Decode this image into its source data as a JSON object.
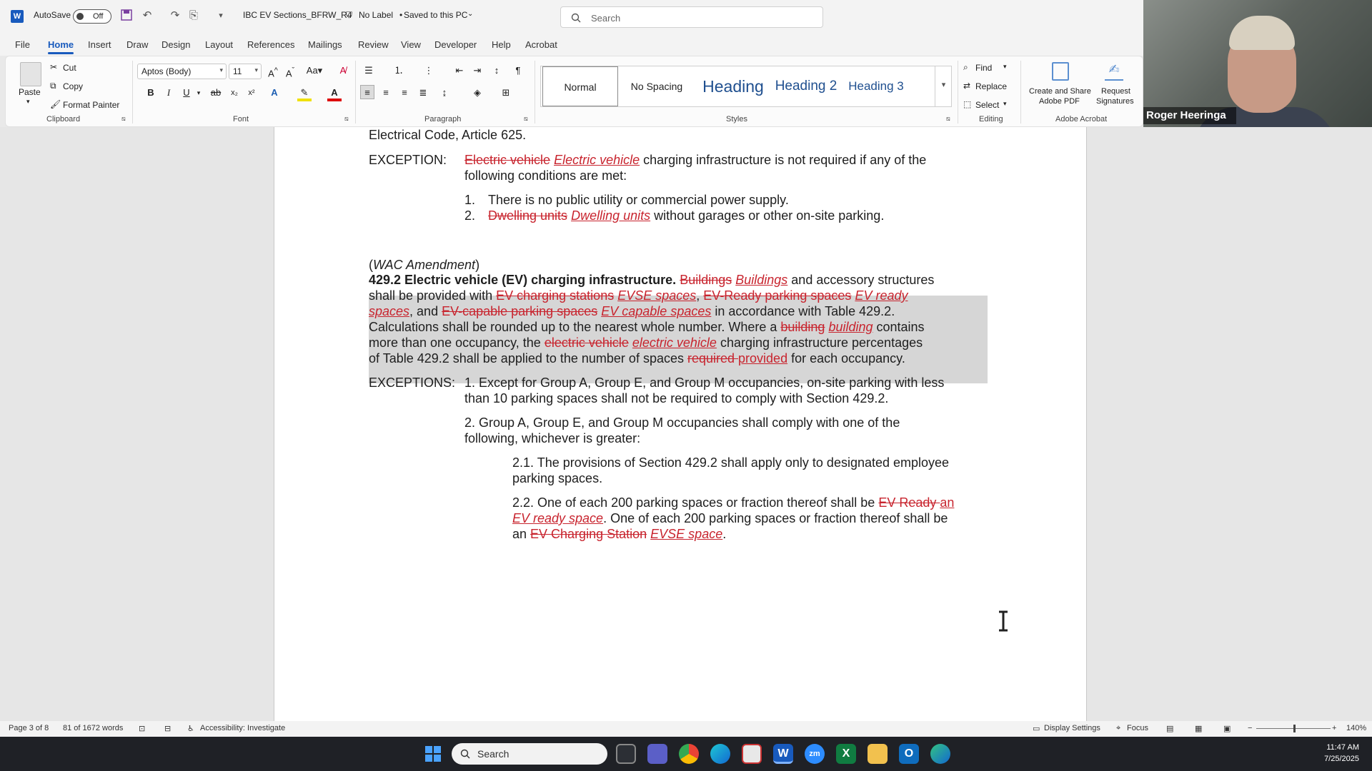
{
  "titlebar": {
    "autosave_label": "AutoSave",
    "autosave_state": "Off",
    "doc_title": "IBC EV Sections_BFRW_R4",
    "sensitivity": "No Label",
    "save_status": "Saved to this PC",
    "search_placeholder": "Search"
  },
  "menu": [
    "File",
    "Home",
    "Insert",
    "Draw",
    "Design",
    "Layout",
    "References",
    "Mailings",
    "Review",
    "View",
    "Developer",
    "Help",
    "Acrobat"
  ],
  "ribbon": {
    "clipboard": {
      "paste": "Paste",
      "cut": "Cut",
      "copy": "Copy",
      "format_painter": "Format Painter",
      "label": "Clipboard"
    },
    "font": {
      "family": "Aptos (Body)",
      "size": "11",
      "label": "Font"
    },
    "paragraph": {
      "label": "Paragraph"
    },
    "styles": {
      "items": [
        "Normal",
        "No Spacing",
        "Heading",
        "Heading 2",
        "Heading 3"
      ],
      "label": "Styles"
    },
    "editing": {
      "find": "Find",
      "replace": "Replace",
      "select": "Select",
      "label": "Editing"
    },
    "acrobat": {
      "create_share": "Create and Share",
      "create_share_2": "Adobe PDF",
      "request": "Request",
      "request_2": "Signatures",
      "label": "Adobe Acrobat"
    }
  },
  "webcam": {
    "name": "Roger Heeringa"
  },
  "document": {
    "l0": "Electrical Code, Article 625.",
    "exc_label": "EXCEPTION:",
    "exc1_del": "Electric vehicle",
    "exc1_ins": "Electric vehicle",
    "exc1_rest": " charging infrastructure is not required if any of the",
    "exc2": "following conditions are met:",
    "item1_num": "1.",
    "item1": "There is no public utility or commercial power supply.",
    "item2_num": "2.",
    "item2_del": "Dwelling units",
    "item2_ins": "Dwelling units",
    "item2_rest": " without garages or other on-site parking.",
    "wac_open": "(",
    "wac": "WAC Amendment",
    "wac_close": ")",
    "p1_bold": "429.2 Electric vehicle (EV) charging infrastructure.",
    "p1_del": "Buildings",
    "p1_ins": "Buildings",
    "p1_rest": " and accessory structures",
    "p2_a": "shall be provided with ",
    "p2_del1": "EV charging stations",
    "p2_ins1": "EVSE spaces",
    "p2_b": ", ",
    "p2_del2": "EV-Ready parking spaces",
    "p2_ins2": "EV ready",
    "p3_ins": "spaces",
    "p3_a": ", and ",
    "p3_del": "EV-capable parking spaces",
    "p3_ins2": "EV capable spaces",
    "p3_rest": " in accordance with Table 429.2.",
    "p4_a": "Calculations shall be rounded up to the nearest whole number. Where a ",
    "p4_del": "building",
    "p4_ins": "building",
    "p4_rest": " contains",
    "p5_a": "more than one occupancy, the ",
    "p5_del": "electric vehicle",
    "p5_ins": "electric vehicle",
    "p5_rest": " charging infrastructure percentages",
    "p6_a": "of Table 429.2 shall be applied to the number of spaces ",
    "p6_del": "required ",
    "p6_ins": "provided",
    "p6_rest": " for each occupancy.",
    "excs_label": "EXCEPTIONS:",
    "e1a": "1. Except for Group A, Group E, and Group M occupancies, on-site parking with less",
    "e1b": "than 10 parking spaces shall not be required to comply with Section 429.2.",
    "e2a": "2. Group A, Group E, and Group M occupancies shall comply with one of the",
    "e2b": "following, whichever is greater:",
    "e21a": "2.1. The provisions of Section 429.2 shall apply only to designated employee",
    "e21b": "parking spaces.",
    "e22a": "2.2. One of each 200 parking spaces or fraction thereof shall be ",
    "e22a_del": "EV Ready ",
    "e22a_ins": "an",
    "e22b_ins": "EV ready space",
    "e22b_rest": ". One of each 200 parking spaces or fraction thereof shall be",
    "e22c_a": "an ",
    "e22c_del": "EV Charging Station",
    "e22c_ins": "EVSE space",
    "e22c_rest": "."
  },
  "statusbar": {
    "page": "Page 3 of 8",
    "words": "81 of 1672 words",
    "accessibility": "Accessibility: Investigate",
    "display": "Display Settings",
    "focus": "Focus",
    "zoom": "140%"
  },
  "taskbar": {
    "search_placeholder": "Search",
    "time": "11:47 AM",
    "date": "7/25/2025"
  },
  "colors": {
    "accent": "#185abd",
    "revision": "#c8242e",
    "highlight": "#d6d6d6"
  }
}
